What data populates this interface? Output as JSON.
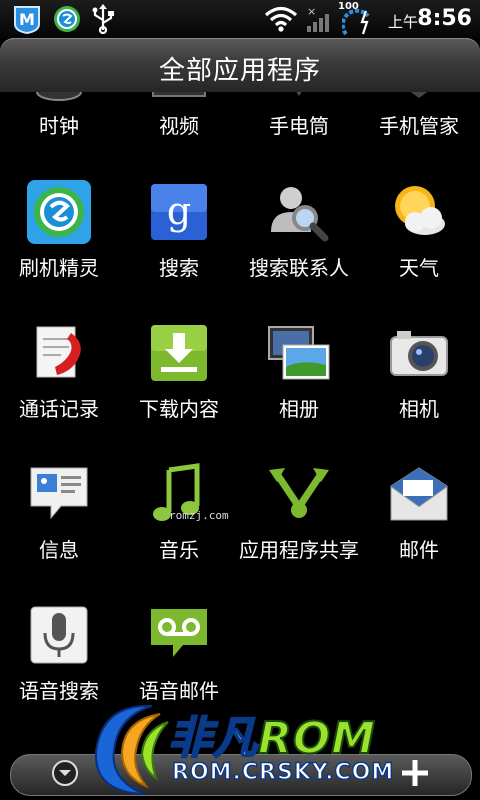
{
  "status_bar": {
    "time": "8:56",
    "ampm": "上午",
    "battery_level": "100",
    "icons": [
      "m-app-icon",
      "security-notify-icon",
      "usb-icon",
      "wifi-icon",
      "signal-icon",
      "battery-charging-icon"
    ]
  },
  "title_bar": {
    "title": "全部应用程序"
  },
  "apps": [
    {
      "label": "时钟",
      "icon": "clock-icon"
    },
    {
      "label": "视频",
      "icon": "video-icon"
    },
    {
      "label": "手电筒",
      "icon": "flashlight-icon"
    },
    {
      "label": "手机管家",
      "icon": "phone-manager-icon"
    },
    {
      "label": "刷机精灵",
      "icon": "flash-wizard-icon"
    },
    {
      "label": "搜索",
      "icon": "google-search-icon"
    },
    {
      "label": "搜索联系人",
      "icon": "search-contacts-icon"
    },
    {
      "label": "天气",
      "icon": "weather-icon"
    },
    {
      "label": "通话记录",
      "icon": "call-log-icon"
    },
    {
      "label": "下载内容",
      "icon": "downloads-icon"
    },
    {
      "label": "相册",
      "icon": "gallery-icon"
    },
    {
      "label": "相机",
      "icon": "camera-icon"
    },
    {
      "label": "信息",
      "icon": "messages-icon"
    },
    {
      "label": "音乐",
      "icon": "music-icon"
    },
    {
      "label": "应用程序共享",
      "icon": "app-share-icon"
    },
    {
      "label": "邮件",
      "icon": "mail-icon"
    },
    {
      "label": "语音搜索",
      "icon": "voice-search-icon"
    },
    {
      "label": "语音邮件",
      "icon": "voicemail-icon"
    }
  ],
  "watermark": "romzj.com",
  "logo": {
    "main_cn": "非凡",
    "main_rom": "ROM",
    "sub": "ROM.CRSKY.COM"
  },
  "colors": {
    "background": "#000000",
    "logo_green": "#9be22b",
    "logo_blue": "#1a66d6"
  }
}
